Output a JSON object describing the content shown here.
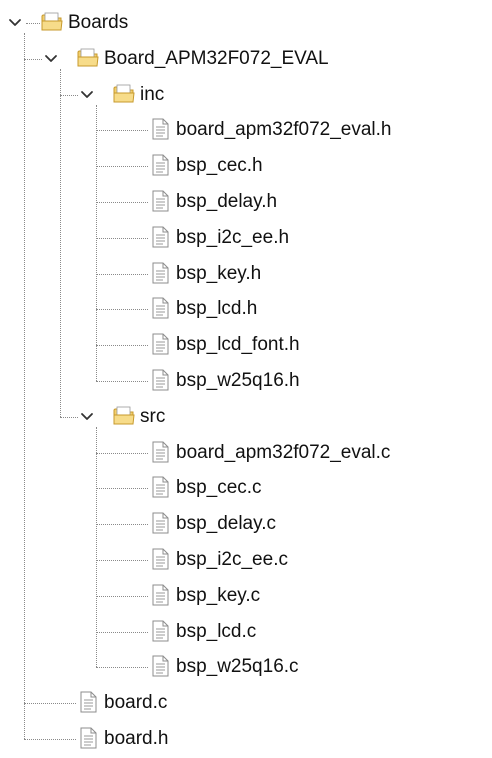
{
  "tree": {
    "label": "Boards",
    "expanded": true,
    "icon": "folder-icon",
    "children": [
      {
        "label": "Board_APM32F072_EVAL",
        "expanded": true,
        "icon": "folder-icon",
        "children": [
          {
            "label": "inc",
            "expanded": true,
            "icon": "folder-icon",
            "children": [
              {
                "label": "board_apm32f072_eval.h",
                "icon": "file-icon"
              },
              {
                "label": "bsp_cec.h",
                "icon": "file-icon"
              },
              {
                "label": "bsp_delay.h",
                "icon": "file-icon"
              },
              {
                "label": "bsp_i2c_ee.h",
                "icon": "file-icon"
              },
              {
                "label": "bsp_key.h",
                "icon": "file-icon"
              },
              {
                "label": "bsp_lcd.h",
                "icon": "file-icon"
              },
              {
                "label": "bsp_lcd_font.h",
                "icon": "file-icon"
              },
              {
                "label": "bsp_w25q16.h",
                "icon": "file-icon"
              }
            ]
          },
          {
            "label": "src",
            "expanded": true,
            "icon": "folder-icon",
            "children": [
              {
                "label": "board_apm32f072_eval.c",
                "icon": "file-icon"
              },
              {
                "label": "bsp_cec.c",
                "icon": "file-icon"
              },
              {
                "label": "bsp_delay.c",
                "icon": "file-icon"
              },
              {
                "label": "bsp_i2c_ee.c",
                "icon": "file-icon"
              },
              {
                "label": "bsp_key.c",
                "icon": "file-icon"
              },
              {
                "label": "bsp_lcd.c",
                "icon": "file-icon"
              },
              {
                "label": "bsp_w25q16.c",
                "icon": "file-icon"
              }
            ]
          }
        ]
      },
      {
        "label": "board.c",
        "icon": "file-icon"
      },
      {
        "label": "board.h",
        "icon": "file-icon"
      }
    ]
  },
  "colors": {
    "folder_fill": "#f3cf6c",
    "folder_edge": "#c79a2c",
    "file_edge": "#8c8c8c",
    "guide_line": "#8a8a8a",
    "text": "#111111"
  }
}
